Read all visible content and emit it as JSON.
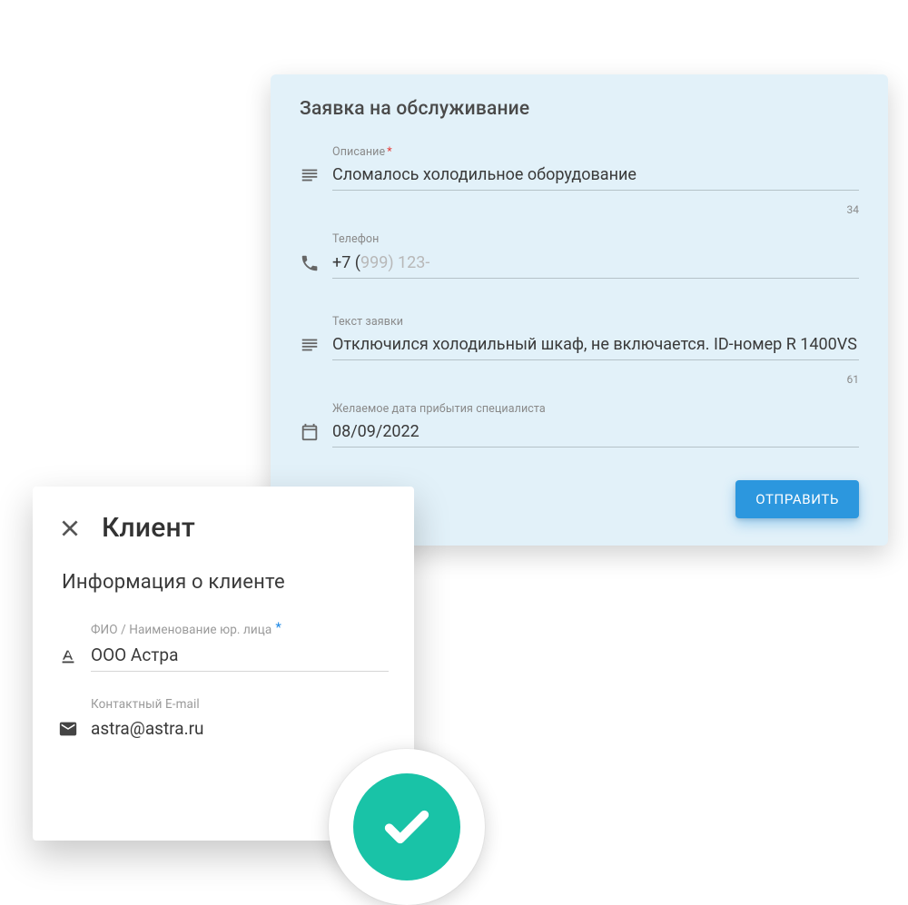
{
  "request": {
    "title": "Заявка на обслуживание",
    "description": {
      "label": "Описание",
      "required_mark": "*",
      "value": "Сломалось холодильное оборудование",
      "char_count": "34"
    },
    "phone": {
      "label": "Телефон",
      "typed": "+7 (",
      "hint": "999) 123-"
    },
    "text": {
      "label": "Текст заявки",
      "value": "Отключился холодильный шкаф, не включается. ID-номер R 1400VS",
      "char_count": "61"
    },
    "date": {
      "label": "Желаемое дата прибытия специалиста",
      "value": "08/09/2022"
    },
    "submit_label": "ОТПРАВИТЬ"
  },
  "client": {
    "panel_title": "Клиент",
    "section_title": "Информация о клиенте",
    "name": {
      "label": "ФИО / Наименование юр. лица",
      "required_mark": "*",
      "value": "ООО Астра"
    },
    "email": {
      "label": "Контактный E-mail",
      "value": "astra@astra.ru"
    }
  }
}
